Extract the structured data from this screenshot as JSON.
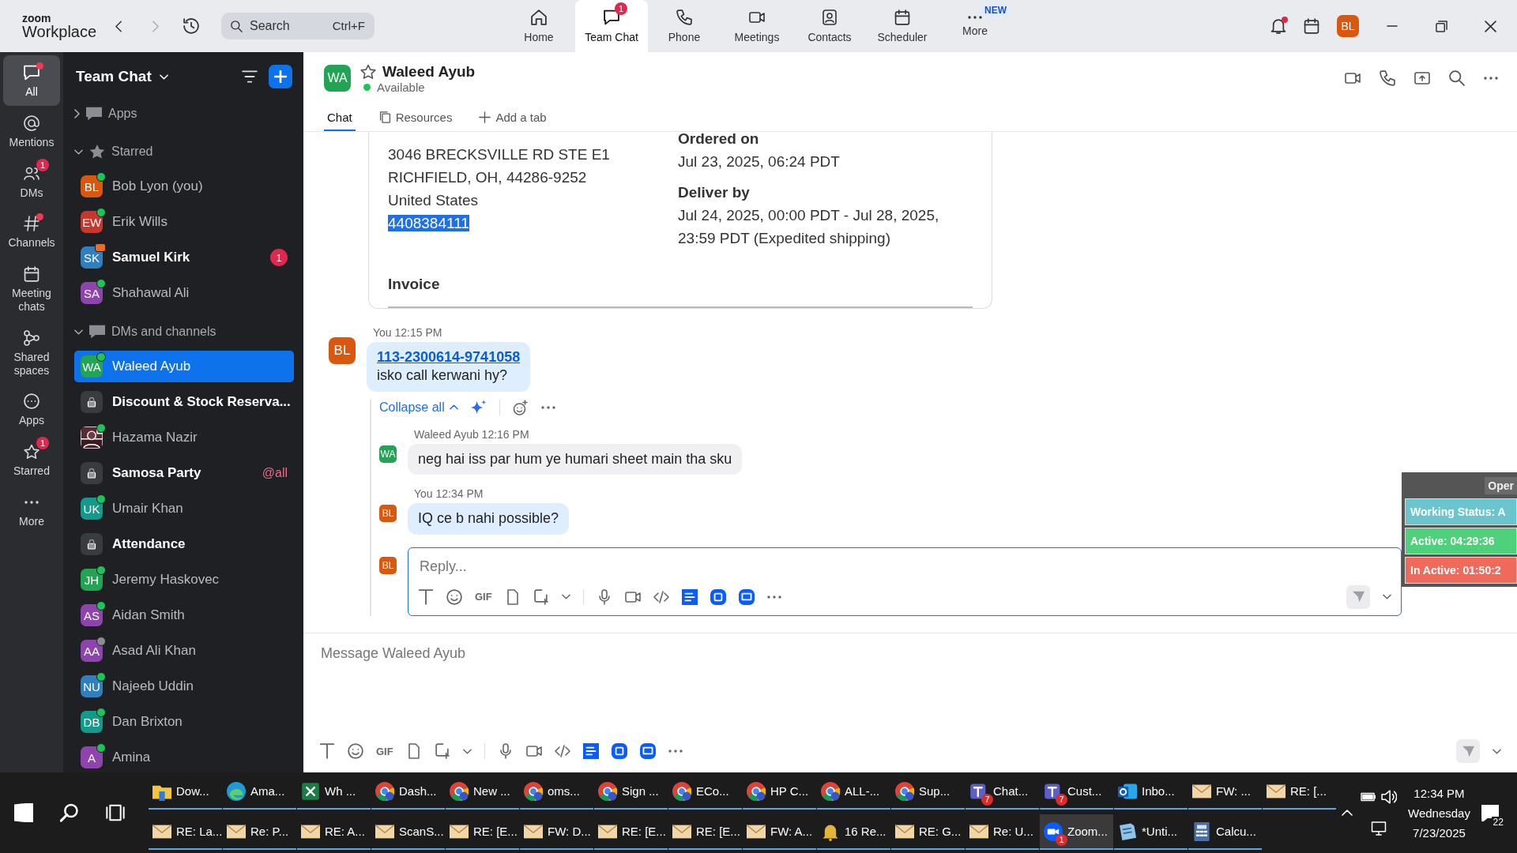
{
  "app": {
    "logo_top": "zoom",
    "logo_bottom": "Workplace",
    "search": {
      "placeholder": "Search",
      "shortcut": "Ctrl+F"
    }
  },
  "nav_tabs": [
    {
      "label": "Home",
      "selected": false
    },
    {
      "label": "Team Chat",
      "selected": true,
      "badge": "1"
    },
    {
      "label": "Phone",
      "selected": false
    },
    {
      "label": "Meetings",
      "selected": false
    },
    {
      "label": "Contacts",
      "selected": false
    },
    {
      "label": "Scheduler",
      "selected": false
    },
    {
      "label": "More",
      "selected": false,
      "tag": "NEW"
    }
  ],
  "profile": {
    "initials": "BL",
    "color": "#d9580f"
  },
  "rail": [
    {
      "label": "All",
      "selected": true,
      "dot": true
    },
    {
      "label": "Mentions",
      "selected": false,
      "dot": false
    },
    {
      "label": "DMs",
      "selected": false,
      "dot": false,
      "badge": "1"
    },
    {
      "label": "Channels",
      "selected": false,
      "dot": true
    },
    {
      "label": "Meeting chats",
      "selected": false,
      "dot": false
    },
    {
      "label": "Shared spaces",
      "selected": false,
      "dot": false
    },
    {
      "label": "Apps",
      "selected": false,
      "dot": false
    },
    {
      "label": "Starred",
      "selected": false,
      "dot": false,
      "badge": "1"
    },
    {
      "label": "More",
      "selected": false,
      "dot": false
    }
  ],
  "panel": {
    "title": "Team Chat",
    "sections": [
      {
        "label": "Apps",
        "expanded": false
      },
      {
        "label": "Starred",
        "expanded": true,
        "items": [
          {
            "kind": "person",
            "initials": "BL",
            "name": "Bob Lyon (you)",
            "color": "#d9580f",
            "online": true,
            "in_meeting": false,
            "unread": false,
            "selected": false
          },
          {
            "kind": "person",
            "initials": "EW",
            "name": "Erik Wills",
            "color": "#c8372d",
            "online": true,
            "in_meeting": false,
            "unread": false,
            "selected": false
          },
          {
            "kind": "person",
            "initials": "SK",
            "name": "Samuel Kirk",
            "color": "#2f7fc1",
            "online": true,
            "in_meeting": true,
            "unread": true,
            "selected": false,
            "badge": "1"
          },
          {
            "kind": "person",
            "initials": "SA",
            "name": "Shahawal Ali",
            "color": "#8e44ad",
            "online": true,
            "in_meeting": false,
            "unread": false,
            "selected": false
          }
        ]
      },
      {
        "label": "DMs and channels",
        "expanded": true,
        "items": [
          {
            "kind": "person",
            "initials": "WA",
            "name": "Waleed Ayub",
            "color": "#23a455",
            "online": true,
            "in_meeting": false,
            "unread": false,
            "selected": true
          },
          {
            "kind": "channel",
            "name": "Discount & Stock Reserva...",
            "unread": true,
            "selected": false
          },
          {
            "name": "Hazama Nazir",
            "online": true,
            "in_meeting": false,
            "unread": false,
            "selected": false
          },
          {
            "kind": "channel",
            "name": "Samosa Party",
            "unread": true,
            "selected": false,
            "mention": "@all"
          },
          {
            "kind": "person",
            "initials": "UK",
            "name": "Umair Khan",
            "color": "#149a8a",
            "online": true,
            "in_meeting": false,
            "unread": false,
            "selected": false
          },
          {
            "kind": "channel",
            "name": "Attendance",
            "unread": true,
            "selected": false
          },
          {
            "kind": "person",
            "initials": "JH",
            "name": "Jeremy Haskovec",
            "color": "#23a455",
            "online": true,
            "in_meeting": false,
            "unread": false,
            "selected": false
          },
          {
            "kind": "person",
            "initials": "AS",
            "name": "Aidan Smith",
            "color": "#8e44ad",
            "online": true,
            "in_meeting": false,
            "unread": false,
            "selected": false
          },
          {
            "kind": "person",
            "initials": "AA",
            "name": "Asad Ali Khan",
            "color": "#8e44ad",
            "online": false,
            "in_meeting": false,
            "unread": false,
            "selected": false
          },
          {
            "kind": "person",
            "initials": "NU",
            "name": "Najeeb Uddin",
            "color": "#2f7fc1",
            "online": true,
            "in_meeting": false,
            "unread": false,
            "selected": false
          },
          {
            "kind": "person",
            "initials": "DB",
            "name": "Dan Brixton",
            "color": "#149a8a",
            "online": true,
            "in_meeting": false,
            "unread": false,
            "selected": false
          },
          {
            "kind": "person",
            "initials": "A",
            "name": "Amina",
            "color": "#8e44ad",
            "online": true,
            "in_meeting": false,
            "unread": false,
            "selected": false
          }
        ]
      }
    ]
  },
  "chat": {
    "initials": "WA",
    "color": "#23a455",
    "name": "Waleed Ayub",
    "status": "Available",
    "tabs": [
      {
        "label": "Chat",
        "selected": true
      },
      {
        "label": "Resources",
        "selected": false
      },
      {
        "label": "Add a tab",
        "selected": false
      }
    ],
    "order_card": {
      "address": [
        "3046 BRECKSVILLE RD STE E1",
        "RICHFIELD, OH, 44286-9252",
        "United States"
      ],
      "phone": "4408384111",
      "ordered_label": "Ordered on",
      "ordered_value": "Jul 23, 2025, 06:24 PDT",
      "deliver_label": "Deliver by",
      "deliver_value": "Jul 24, 2025, 00:00 PDT - Jul 28, 2025, 23:59 PDT (Expedited shipping)",
      "invoice_label": "Invoice"
    },
    "message": {
      "sender": "You",
      "time": "12:15 PM",
      "initials": "BL",
      "color": "#d9580f",
      "link": "113-2300614-9741058",
      "text": "isko call kerwani hy?"
    },
    "collapse_label": "Collapse all",
    "replies": [
      {
        "sender": "Waleed Ayub",
        "time": "12:16 PM",
        "initials": "WA",
        "color": "#23a455",
        "text": "neg hai iss par hum ye humari sheet main tha sku",
        "mine": false
      },
      {
        "sender": "You",
        "time": "12:34 PM",
        "initials": "BL",
        "color": "#d9580f",
        "text": "IQ ce b nahi possible?",
        "mine": true
      }
    ],
    "reply_box": {
      "initials": "BL",
      "color": "#d9580f",
      "placeholder": "Reply...",
      "gif": "GIF"
    },
    "composer": {
      "placeholder": "Message Waleed Ayub",
      "gif": "GIF"
    }
  },
  "tracker": {
    "button": "Oper",
    "rows": [
      {
        "text": "Working Status: A",
        "color": "#6cc5cc"
      },
      {
        "text": "Active: 04:29:36",
        "color": "#4fd07a"
      },
      {
        "text": "In Active: 01:50:2",
        "color": "#ef6a5a"
      }
    ]
  },
  "taskbar": {
    "rows": [
      [
        {
          "kind": "folder",
          "label": "Dow...",
          "selected": false
        },
        {
          "kind": "edge",
          "label": "Ama...",
          "selected": false
        },
        {
          "kind": "excel",
          "label": "Wh ...",
          "selected": false
        },
        {
          "kind": "chrome",
          "label": "Dash...",
          "selected": false
        },
        {
          "kind": "chrome",
          "label": "New ...",
          "selected": false
        },
        {
          "kind": "chrome",
          "label": "oms...",
          "selected": false
        },
        {
          "kind": "chrome",
          "label": "Sign ...",
          "selected": false
        },
        {
          "kind": "chrome",
          "label": "ECo...",
          "selected": false
        },
        {
          "kind": "chrome",
          "label": "HP C...",
          "selected": false
        },
        {
          "kind": "chrome",
          "label": "ALL-...",
          "selected": false
        },
        {
          "kind": "chrome",
          "label": "Sup...",
          "selected": false
        },
        {
          "kind": "teams",
          "label": "Chat...",
          "badge": "7",
          "selected": false
        },
        {
          "kind": "teams",
          "label": "Cust...",
          "badge": "7",
          "selected": false
        },
        {
          "kind": "outlook",
          "label": "Inbo...",
          "selected": false
        },
        {
          "kind": "mail",
          "label": "FW: ...",
          "selected": false
        },
        {
          "kind": "mail",
          "label": "RE: [...",
          "selected": false
        }
      ],
      [
        {
          "kind": "mail",
          "label": "RE: La...",
          "selected": false
        },
        {
          "kind": "mail",
          "label": "Re: P...",
          "selected": false
        },
        {
          "kind": "mail",
          "label": "RE: A...",
          "selected": false
        },
        {
          "kind": "mail",
          "label": "ScanS...",
          "selected": false
        },
        {
          "kind": "mail",
          "label": "RE: [E...",
          "selected": false
        },
        {
          "kind": "mail",
          "label": "FW: D...",
          "selected": false
        },
        {
          "kind": "mail",
          "label": "RE: [E...",
          "selected": false
        },
        {
          "kind": "mail",
          "label": "RE: [E...",
          "selected": false
        },
        {
          "kind": "mail",
          "label": "FW: A...",
          "selected": false
        },
        {
          "kind": "bell",
          "label": "16 Re...",
          "selected": false
        },
        {
          "kind": "mail",
          "label": "RE: G...",
          "selected": false
        },
        {
          "kind": "mail",
          "label": "Re: U...",
          "selected": false
        },
        {
          "kind": "zoom",
          "label": "Zoom...",
          "badge": "1",
          "selected": true
        },
        {
          "kind": "notepad",
          "label": "*Unti...",
          "selected": false
        },
        {
          "kind": "calc",
          "label": "Calcu...",
          "selected": false
        }
      ]
    ],
    "time": "12:34 PM",
    "day": "Wednesday",
    "date": "7/23/2025",
    "notifications": "22"
  }
}
